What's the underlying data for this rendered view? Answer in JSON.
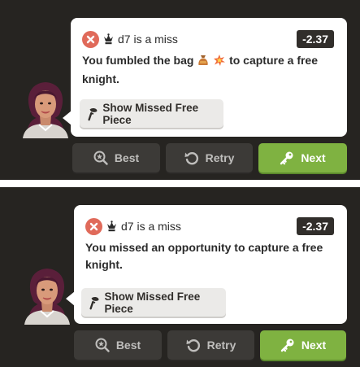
{
  "colors": {
    "background": "#262421",
    "bubble": "#ffffff",
    "miss_red": "#e06a5a",
    "score_badge": "#312e2b",
    "next_green": "#7fb241",
    "dark_button": "#3c3a37"
  },
  "panels": [
    {
      "move_text": "d7 is a miss",
      "score": "-2.37",
      "message_before": "You fumbled the bag",
      "message_icons": [
        "money-bag-icon",
        "explosion-icon"
      ],
      "message_after": "to capture a free knight.",
      "show_button_label": "Show Missed Free Piece",
      "best_label": "Best",
      "retry_label": "Retry",
      "next_label": "Next"
    },
    {
      "move_text": "d7 is a miss",
      "score": "-2.37",
      "message_before": "You missed an opportunity to capture a free knight.",
      "message_icons": [],
      "message_after": "",
      "show_button_label": "Show Missed Free Piece",
      "best_label": "Best",
      "retry_label": "Retry",
      "next_label": "Next"
    }
  ]
}
